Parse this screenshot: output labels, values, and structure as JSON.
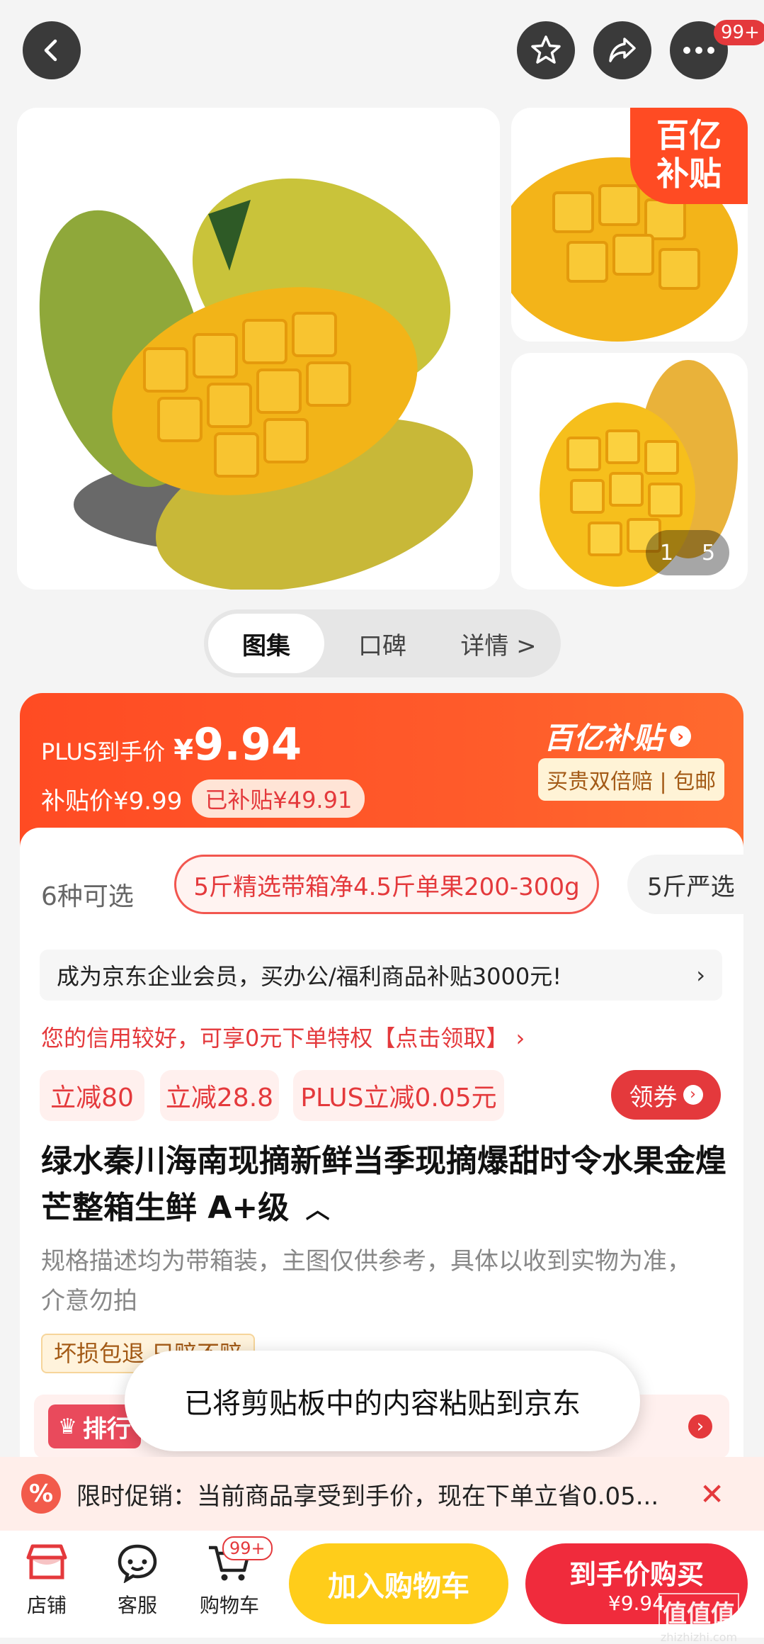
{
  "topbar": {
    "more_badge": "99+"
  },
  "gallery": {
    "subsidy_badge_line1": "百亿",
    "subsidy_badge_line2": "补贴",
    "counter_current": "1",
    "counter_total": "5"
  },
  "tabs": [
    {
      "label": "图集"
    },
    {
      "label": "口碑"
    },
    {
      "label": "详情 >"
    }
  ],
  "price": {
    "plus_label": "PLUS到手价",
    "plus_currency": "¥",
    "plus_value": "9.94",
    "subsidy_label": "补贴价¥9.99",
    "subsidy_amount": "已补贴¥49.91",
    "brand": "百亿补贴",
    "guarantee": "买贵双倍赔 | 包邮"
  },
  "specs": {
    "count_label": "6种可选",
    "selected": "5斤精选带箱净4.5斤单果200-300g",
    "next": "5斤严选"
  },
  "promo": {
    "enterprise": "成为京东企业会员，买办公/福利商品补贴3000元!",
    "credit": "您的信用较好，可享0元下单特权【点击领取】 ›"
  },
  "coupons": [
    "立减80",
    "立减28.8",
    "PLUS立减0.05元"
  ],
  "coupon_button": "领券",
  "product": {
    "title": "绿水秦川海南现摘新鲜当季现摘爆甜时令水果金煌芒整箱生鲜 A+级",
    "desc": "规格描述均为带箱装，主图仅供参考，具体以收到实物为准，介意勿拍",
    "tag": "坏损包退  只赔不赔",
    "rank_label": "排行"
  },
  "toast": "已将剪贴板中的内容粘贴到京东",
  "limited_promo": "限时促销：当前商品享受到手价，现在下单立省0.05...",
  "bottom": {
    "store": "店铺",
    "service": "客服",
    "cart": "购物车",
    "cart_badge": "99+",
    "add_cart": "加入购物车",
    "buy_label": "到手价购买",
    "buy_price": "¥9.94"
  },
  "watermark": "值值值",
  "watermark_url": "zhizhizhi.com",
  "colors": {
    "accent": "#ff4b23",
    "red": "#e4393c",
    "yellow": "#ffcc1a"
  }
}
